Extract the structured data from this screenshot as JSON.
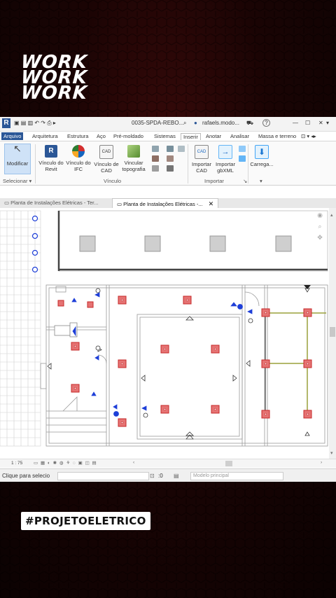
{
  "story": {
    "top_lines": [
      "WORK",
      "WORK",
      "WORK"
    ],
    "hashtag": "#PROJETOELETRICO"
  },
  "window": {
    "file_title": "0035-SPDA-REBO...",
    "user": "rafaels.modo...",
    "help": "?"
  },
  "ribbon_tabs": [
    "Arquivo",
    "Arquitetura",
    "Estrutura",
    "Aço",
    "Pré-moldado",
    "Sistemas",
    "Inserir",
    "Anotar",
    "Analisar",
    "Massa e terreno"
  ],
  "ribbon": {
    "modify": "Modificar",
    "select_label": "Selecionar",
    "link_revit": [
      "Vínculo do",
      "Revit"
    ],
    "link_ifc": [
      "Vínculo do",
      "IFC"
    ],
    "link_cad": [
      "Vínculo de",
      "CAD"
    ],
    "link_topo": [
      "Vincular",
      "topografia"
    ],
    "import_cad": [
      "Importar",
      "CAD"
    ],
    "import_gbxml": [
      "Importar",
      "gbXML"
    ],
    "load": [
      "Carrega..."
    ],
    "group_link": "Vínculo",
    "group_import": "Importar"
  },
  "view_tabs": {
    "tab1": "Planta de Instalações Elétricas - Ter...",
    "tab2": "Planta de Instalações Elétricas -..."
  },
  "view_bar": {
    "scale": "1 : 75"
  },
  "status_bar": {
    "hint": "Clique para selecio",
    "zero": ":0",
    "model": "Modelo principal"
  },
  "colors": {
    "accent": "#2b5797",
    "fixture_fill": "#e57373",
    "fixture_border": "#c62828",
    "wire": "#9aa03a",
    "symbol_blue": "#1e3fd8"
  }
}
